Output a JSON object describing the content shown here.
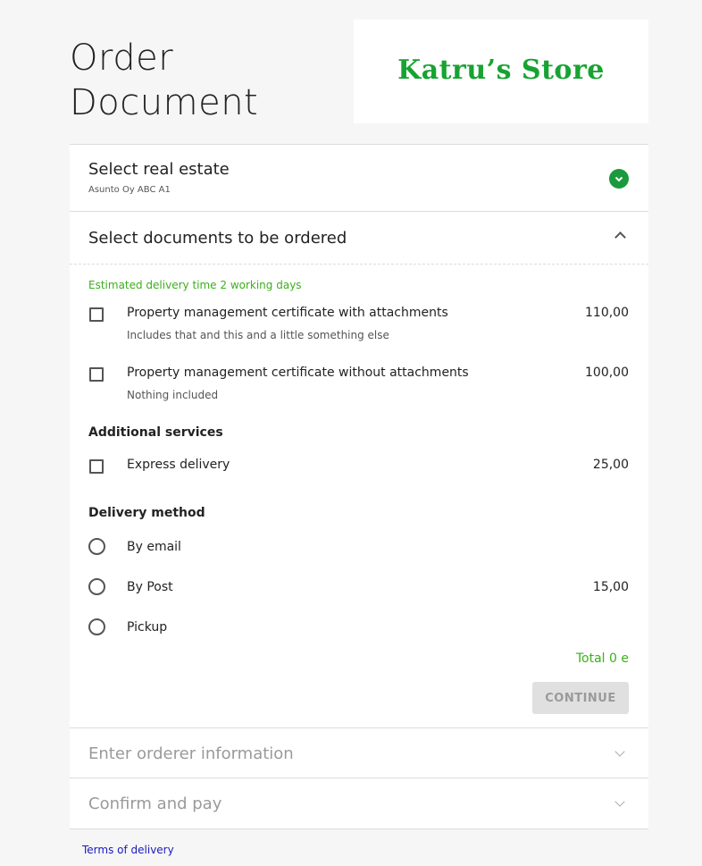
{
  "header": {
    "title_line1": "Order",
    "title_line2": "Document",
    "logo_text": "Katru’s Store"
  },
  "real_estate": {
    "title": "Select real estate",
    "selected": "Asunto Oy ABC A1",
    "status_icon": "check-circle-icon"
  },
  "documents": {
    "title": "Select documents to be ordered",
    "estimate": "Estimated delivery time 2 working days",
    "items": [
      {
        "label": "Property management certificate with attachments",
        "desc": "Includes that and this and a little something else",
        "price": "110,00"
      },
      {
        "label": "Property management certificate without attachments",
        "desc": "Nothing included",
        "price": "100,00"
      }
    ],
    "additional_title": "Additional services",
    "additional": [
      {
        "label": "Express delivery",
        "price": "25,00"
      }
    ],
    "delivery_title": "Delivery method",
    "delivery": [
      {
        "label": "By email",
        "price": ""
      },
      {
        "label": "By Post",
        "price": "15,00"
      },
      {
        "label": "Pickup",
        "price": ""
      }
    ],
    "total": "Total 0 e",
    "continue_label": "CONTINUE"
  },
  "orderer": {
    "title": "Enter orderer information"
  },
  "confirm": {
    "title": "Confirm and pay"
  },
  "footer": {
    "terms": "Terms of delivery"
  },
  "colors": {
    "accent_green": "#3ab01a",
    "check_green": "#1a9a3c",
    "logo_green": "#17a331",
    "link_blue": "#1a1ac0"
  }
}
